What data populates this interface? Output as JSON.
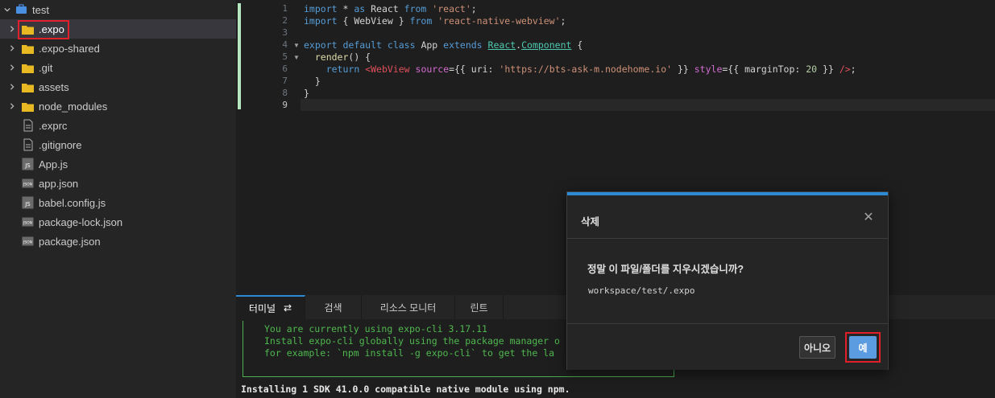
{
  "sidebar": {
    "root": {
      "label": "test",
      "icon": "briefcase-icon"
    },
    "items": [
      {
        "label": ".expo",
        "type": "folder",
        "selected": true
      },
      {
        "label": ".expo-shared",
        "type": "folder"
      },
      {
        "label": ".git",
        "type": "folder"
      },
      {
        "label": "assets",
        "type": "folder"
      },
      {
        "label": "node_modules",
        "type": "folder"
      },
      {
        "label": ".exprc",
        "type": "file",
        "badge": ""
      },
      {
        "label": ".gitignore",
        "type": "file",
        "badge": ""
      },
      {
        "label": "App.js",
        "type": "file",
        "badge": "JS"
      },
      {
        "label": "app.json",
        "type": "file",
        "badge": "JSON"
      },
      {
        "label": "babel.config.js",
        "type": "file",
        "badge": "JS"
      },
      {
        "label": "package-lock.json",
        "type": "file",
        "badge": "JSON"
      },
      {
        "label": "package.json",
        "type": "file",
        "badge": "JSON"
      }
    ]
  },
  "editor": {
    "line_numbers": [
      "1",
      "2",
      "3",
      "4",
      "5",
      "6",
      "7",
      "8",
      "9"
    ],
    "code": {
      "l1": {
        "a": "import",
        "b": " * ",
        "c": "as",
        "d": " React ",
        "e": "from",
        "f": " ",
        "g": "'react'",
        "h": ";"
      },
      "l2": {
        "a": "import",
        "b": " { WebView } ",
        "c": "from",
        "d": " ",
        "e": "'react-native-webview'",
        "f": ";"
      },
      "l4": {
        "a": "export",
        "b": " ",
        "c": "default",
        "d": " ",
        "e": "class",
        "f": " App ",
        "g": "extends",
        "h": " ",
        "i": "React",
        "j": ".",
        "k": "Component",
        "l": " {"
      },
      "l5": {
        "a": "  ",
        "b": "render",
        "c": "() {"
      },
      "l6": {
        "a": "    ",
        "b": "return",
        "c": " ",
        "d": "<WebView",
        "e": " ",
        "f": "source",
        "g": "={{ ",
        "h": "uri",
        "i": ": ",
        "j": "'https://bts-ask-m.nodehome.io'",
        "k": " }} ",
        "l": "style",
        "m": "={{ ",
        "n": "marginTop",
        "o": ": ",
        "p": "20",
        "q": " }} ",
        "r": "/>",
        "s": ";"
      },
      "l7": "  }",
      "l8": "}"
    }
  },
  "panel": {
    "tabs": [
      {
        "label": "터미널",
        "active": true
      },
      {
        "label": "검색"
      },
      {
        "label": "리소스 모니터"
      },
      {
        "label": "린트"
      }
    ],
    "terminal_lines": [
      "You are currently using expo-cli 3.17.11",
      "Install expo-cli globally using the package manager o",
      "for example: `npm install -g expo-cli` to get the la"
    ],
    "terminal_output": "Installing 1 SDK 41.0.0 compatible native module using npm."
  },
  "dialog": {
    "title": "삭제",
    "message": "정말 이 파일/폴더를 지우시겠습니까?",
    "path": "workspace/test/.expo",
    "no_label": "아니오",
    "yes_label": "예"
  },
  "colors": {
    "accent": "#2d8bd6",
    "highlight": "#e0202a",
    "folder": "#e8b923",
    "primary_button": "#5b9be0"
  }
}
